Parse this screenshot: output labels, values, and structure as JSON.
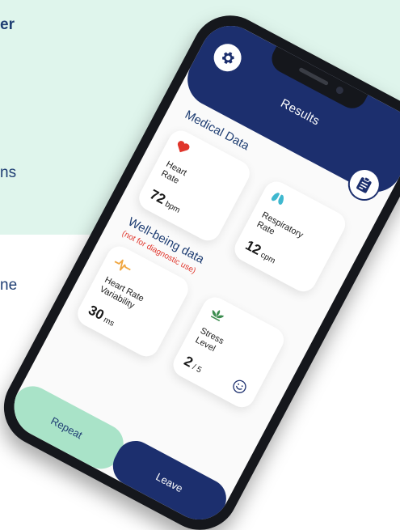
{
  "background_copy": {
    "line1": "er",
    "line2": "ns",
    "line3": "ne"
  },
  "app": {
    "title": "Results",
    "settings_icon": "gear-icon",
    "report_icon": "clipboard-icon"
  },
  "medical": {
    "title": "Medical Data",
    "cards": [
      {
        "icon": "heart-icon",
        "label_1": "Heart",
        "label_2": "Rate",
        "value": "72",
        "unit": "bpm",
        "color": "#e0352b"
      },
      {
        "icon": "lungs-icon",
        "label_1": "Respiratory",
        "label_2": "Rate",
        "value": "12",
        "unit": "cpm",
        "color": "#3fb8cf"
      }
    ]
  },
  "wellbeing": {
    "title": "Well-being data",
    "note": "(not for diagnostic use)",
    "cards": [
      {
        "icon": "heartbeat-wave-icon",
        "label_1": "Heart Rate",
        "label_2": "Variability",
        "value": "30",
        "unit": "ms",
        "color": "#f0a640"
      },
      {
        "icon": "lotus-icon",
        "label_1": "Stress",
        "label_2": "Level",
        "value": "2",
        "unit": "/ 5",
        "color": "#3c8d4f",
        "mood_icon": "smiley-icon"
      }
    ]
  },
  "actions": {
    "repeat": "Repeat",
    "leave": "Leave"
  },
  "colors": {
    "brand_navy": "#1c2f6e",
    "mint": "#a9e3c8",
    "background_mint": "#dff5ec",
    "alert_red": "#e0352b"
  }
}
